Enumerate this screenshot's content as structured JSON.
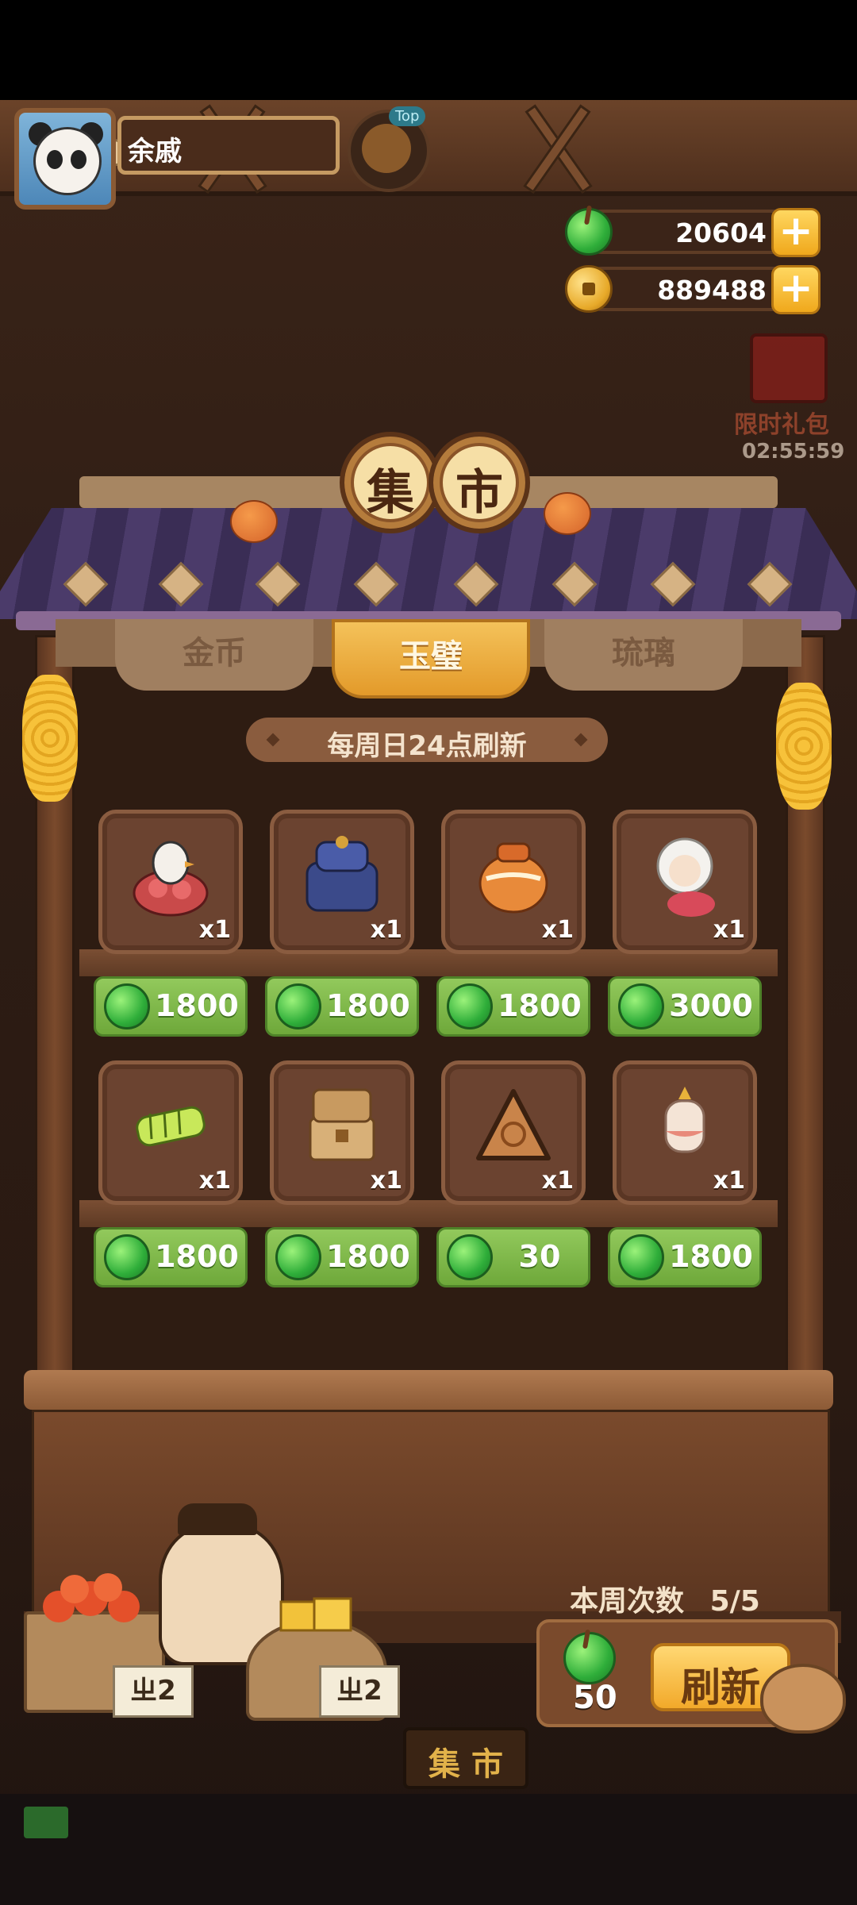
{
  "player": {
    "name": "余戚"
  },
  "top_badge": {
    "tag": "Top"
  },
  "resources": {
    "jade": "20604",
    "coins": "889488"
  },
  "limited_gift": {
    "label": "限时礼包",
    "timer": "02:55:59"
  },
  "sign": {
    "char1": "集",
    "char2": "市"
  },
  "tabs": [
    {
      "label": "金币",
      "active": false
    },
    {
      "label": "玉璧",
      "active": true
    },
    {
      "label": "琉璃",
      "active": false
    }
  ],
  "notice": "每周日24点刷新",
  "items": [
    {
      "qty": "x1",
      "price": "1800",
      "icon": "bird-flower-basket-icon"
    },
    {
      "qty": "x1",
      "price": "1800",
      "icon": "blue-cake-jar-icon"
    },
    {
      "qty": "x1",
      "price": "1800",
      "icon": "orange-jar-icon"
    },
    {
      "qty": "x1",
      "price": "3000",
      "icon": "white-hair-character-icon"
    },
    {
      "qty": "x1",
      "price": "1800",
      "icon": "jade-comb-icon"
    },
    {
      "qty": "x1",
      "price": "1800",
      "icon": "treasure-chest-icon"
    },
    {
      "qty": "x1",
      "price": "30",
      "icon": "triangle-cake-icon"
    },
    {
      "qty": "x1",
      "price": "1800",
      "icon": "lantern-vase-icon"
    }
  ],
  "weekly": {
    "label": "本周次数",
    "count": "5/5"
  },
  "refresh": {
    "cost": "50",
    "label": "刷新"
  },
  "crate_tags": [
    "ㄓ2",
    "ㄓ2"
  ],
  "bottom_sign": "集 市",
  "colors": {
    "price_green": "#7ab548",
    "tab_active": "#f0b042",
    "wood": "#6b4330"
  }
}
